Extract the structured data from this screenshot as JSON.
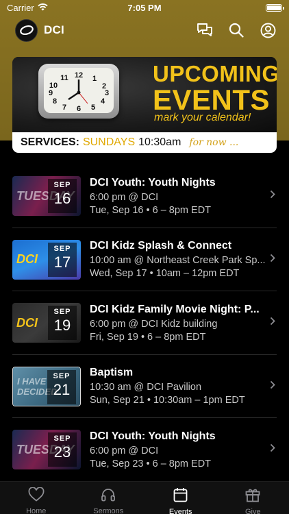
{
  "status_bar": {
    "carrier": "Carrier",
    "time": "7:05 PM"
  },
  "nav": {
    "title": "DCI",
    "icons": [
      "chat-icon",
      "search-icon",
      "account-icon"
    ]
  },
  "hero": {
    "line1": "UPCOMING",
    "line2": "EVENTS",
    "subtitle": "mark your calendar!",
    "services_label": "SERVICES:",
    "services_days": "SUNDAYS",
    "services_time": "10:30am",
    "services_note": "for now ...",
    "accent_color": "#f2c21a"
  },
  "events": [
    {
      "title": "DCI Youth: Youth Nights",
      "meta": "6:00 pm @ DCI",
      "when": "Tue, Sep 16 • 6 – 8pm EDT",
      "month": "SEP",
      "day": "16",
      "thumb_text": "TUESDAY"
    },
    {
      "title": "DCI Kidz Splash & Connect",
      "meta": "10:00 am @ Northeast Creek Park Sp...",
      "when": "Wed, Sep 17 • 10am – 12pm EDT",
      "month": "SEP",
      "day": "17",
      "thumb_text": "DCI"
    },
    {
      "title": "DCI Kidz Family Movie Night: P...",
      "meta": "6:00 pm @ DCI Kidz building",
      "when": "Fri, Sep 19 • 6 – 8pm EDT",
      "month": "SEP",
      "day": "19",
      "thumb_text": "DCI"
    },
    {
      "title": "Baptism",
      "meta": "10:30 am @ DCI Pavilion",
      "when": "Sun, Sep 21 • 10:30am – 1pm EDT",
      "month": "SEP",
      "day": "21",
      "thumb_text": "I HAVE DECIDED"
    },
    {
      "title": "DCI Youth: Youth Nights",
      "meta": "6:00 pm @ DCI",
      "when": "Tue, Sep 23 • 6 – 8pm EDT",
      "month": "SEP",
      "day": "23",
      "thumb_text": "TUESDAY"
    }
  ],
  "tabs": [
    {
      "label": "Home",
      "icon": "heart-icon",
      "active": false
    },
    {
      "label": "Sermons",
      "icon": "headphones-icon",
      "active": false
    },
    {
      "label": "Events",
      "icon": "calendar-icon",
      "active": true
    },
    {
      "label": "Give",
      "icon": "gift-icon",
      "active": false
    }
  ]
}
